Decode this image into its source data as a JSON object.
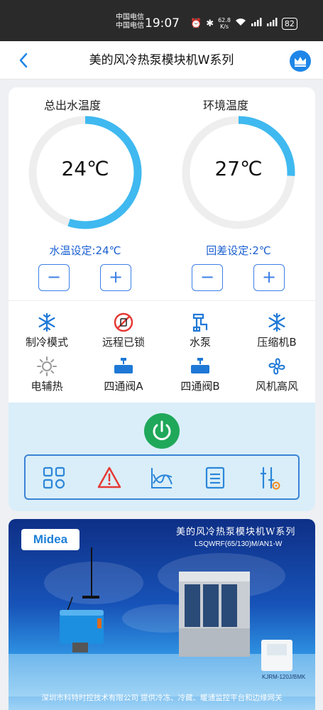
{
  "status_bar": {
    "carrier1": "中国电信",
    "carrier2": "中国电信",
    "time": "19:07",
    "net_speed_value": "62.8",
    "net_speed_unit": "K/s",
    "battery": "82"
  },
  "header": {
    "title": "美的风冷热泵模块机W系列"
  },
  "gauges": [
    {
      "label": "总出水温度",
      "value": "24℃",
      "progress": 0.55,
      "setting": "水温设定:24℃"
    },
    {
      "label": "环境温度",
      "value": "27℃",
      "progress": 0.26,
      "setting": "回差设定:2℃"
    }
  ],
  "stepper": {
    "minus": "−",
    "plus": "+"
  },
  "status_items": [
    {
      "label": "制冷模式",
      "icon": "snowflake-icon"
    },
    {
      "label": "远程已锁",
      "icon": "remote-locked-icon"
    },
    {
      "label": "水泵",
      "icon": "pump-icon"
    },
    {
      "label": "压缩机B",
      "icon": "snowflake-icon"
    },
    {
      "label": "电辅热",
      "icon": "sun-icon"
    },
    {
      "label": "四通阀A",
      "icon": "valve-icon"
    },
    {
      "label": "四通阀B",
      "icon": "valve-icon"
    },
    {
      "label": "风机高风",
      "icon": "fan-icon"
    }
  ],
  "toolbar": [
    "grid-icon",
    "alarm-icon",
    "curve-icon",
    "list-icon",
    "settings-icon"
  ],
  "banner": {
    "logo": "Midea",
    "title": "美的风冷热泵模块机W系列",
    "model": "LSQWRF(65/130)M/AN1-W",
    "thermostat_label": "KJRM-120J/BMK",
    "footer": "深圳市科特时控技术有限公司   提供冷冻、冷藏、暖通监控平台和边缘网关"
  },
  "colors": {
    "accent": "#1e86e8",
    "gauge_arc": "#3fb9f0",
    "power": "#1fa85a",
    "alarm": "#e53935"
  }
}
